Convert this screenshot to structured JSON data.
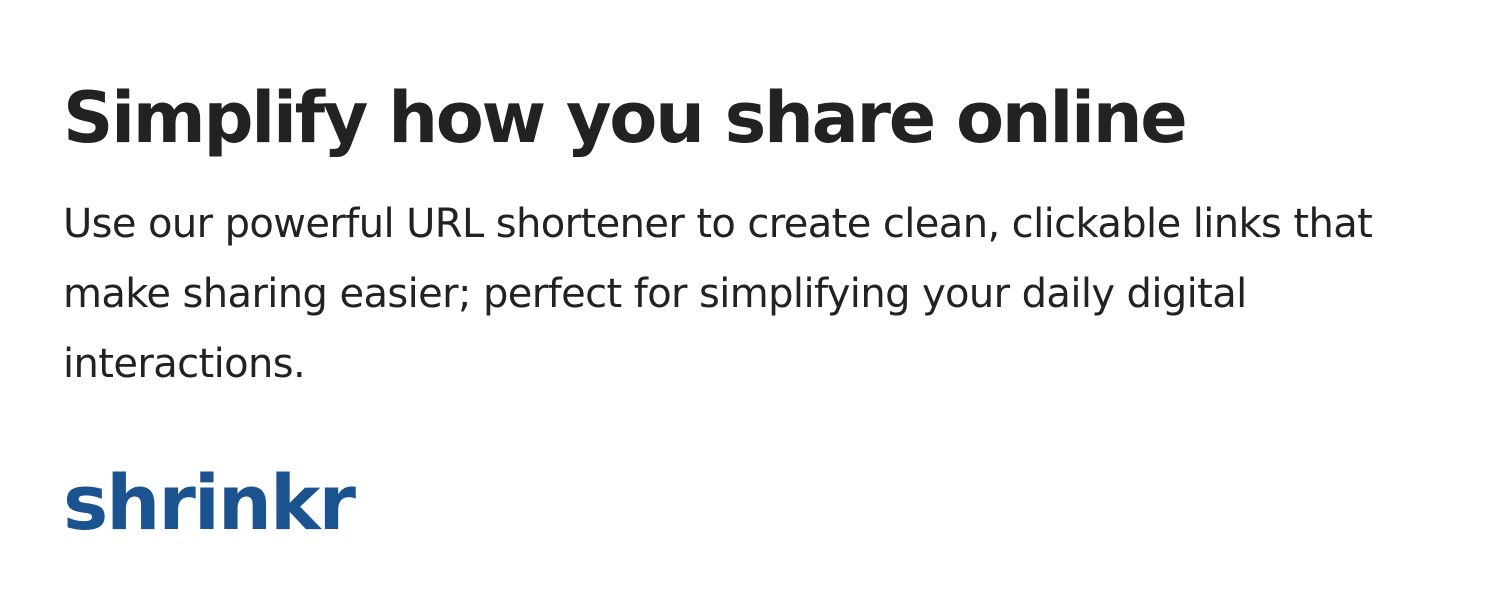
{
  "hero": {
    "title": "Simplify how you share online",
    "description": "Use our powerful URL shortener to create clean, clickable links that make sharing easier; perfect for simplifying your daily digital interactions."
  },
  "brand": {
    "name": "shrinkr",
    "color": "#1b5290"
  },
  "colors": {
    "text": "#222222",
    "background": "#ffffff"
  }
}
